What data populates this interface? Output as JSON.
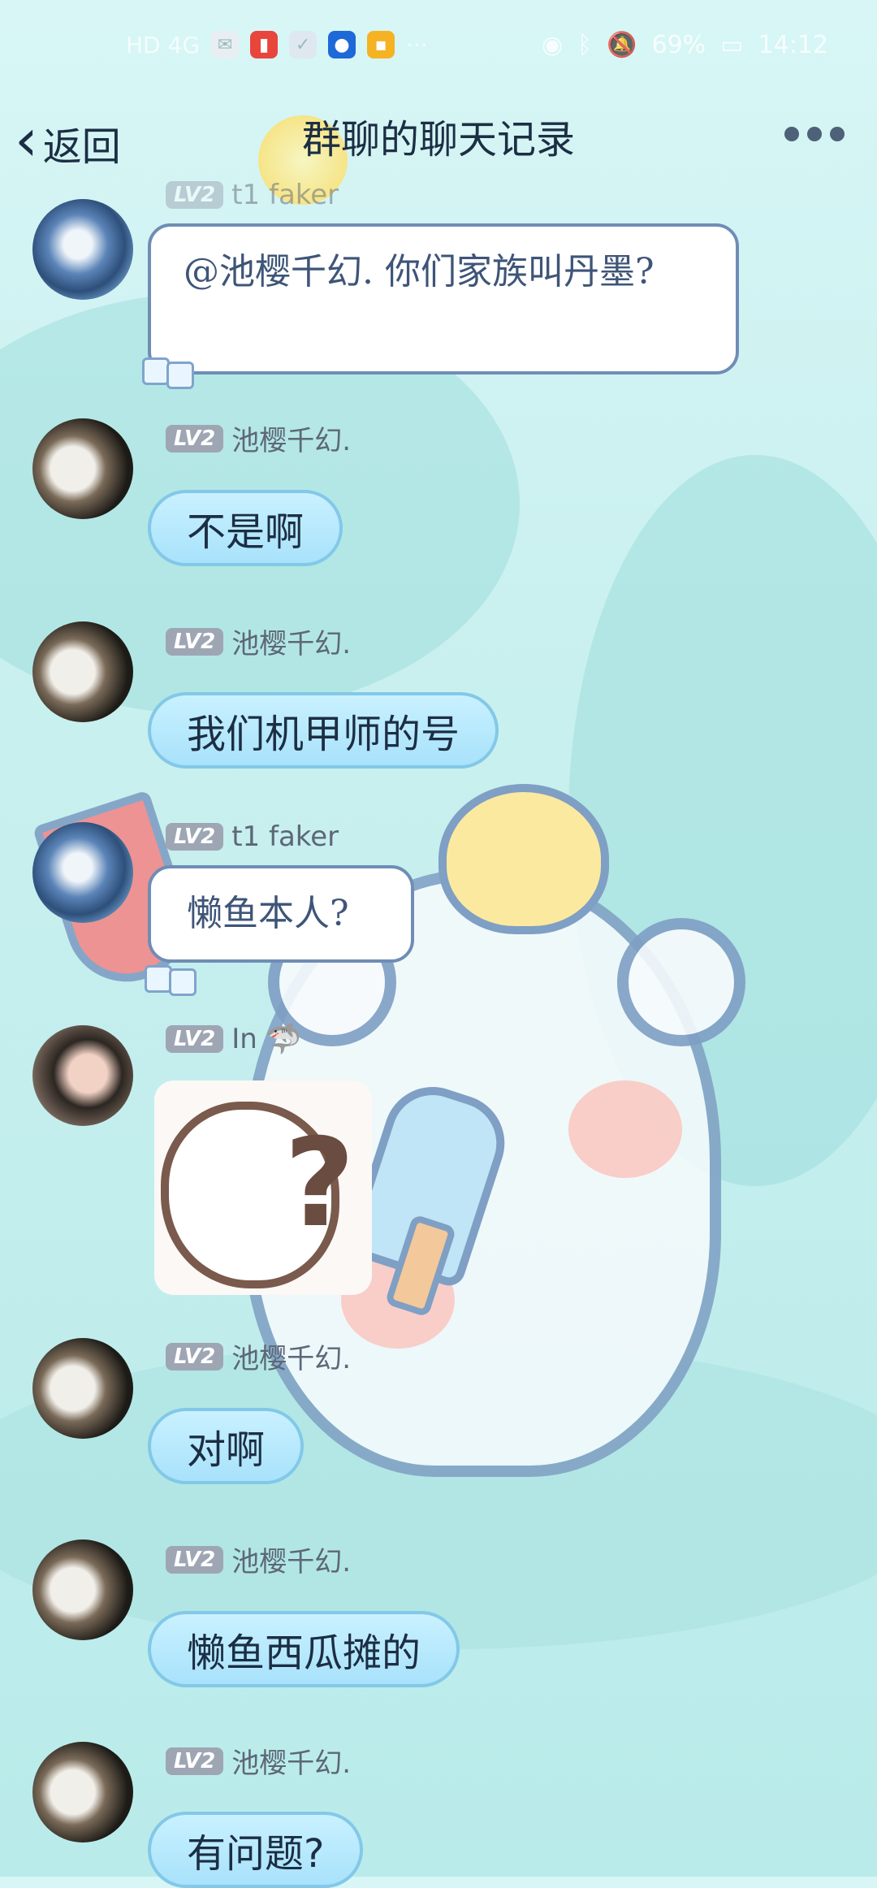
{
  "status_bar": {
    "left_text": "HD 4G",
    "battery": "69%",
    "time": "14:12"
  },
  "header": {
    "back_label": "返回",
    "title": "群聊的聊天记录"
  },
  "messages": [
    {
      "lv": "LV2",
      "name": "t1 faker",
      "text": "@池樱千幻. 你们家族叫丹墨?"
    },
    {
      "lv": "LV2",
      "name": "池樱千幻.",
      "text": "不是啊"
    },
    {
      "lv": "LV2",
      "name": "池樱千幻.",
      "text": "我们机甲师的号"
    },
    {
      "lv": "LV2",
      "name": "t1 faker",
      "text": "懒鱼本人?"
    },
    {
      "lv": "LV2",
      "name": "In"
    },
    {
      "lv": "LV2",
      "name": "池樱千幻.",
      "text": "对啊"
    },
    {
      "lv": "LV2",
      "name": "池樱千幻.",
      "text": "懒鱼西瓜摊的"
    },
    {
      "lv": "LV2",
      "name": "池樱千幻.",
      "text": "有问题?"
    }
  ]
}
